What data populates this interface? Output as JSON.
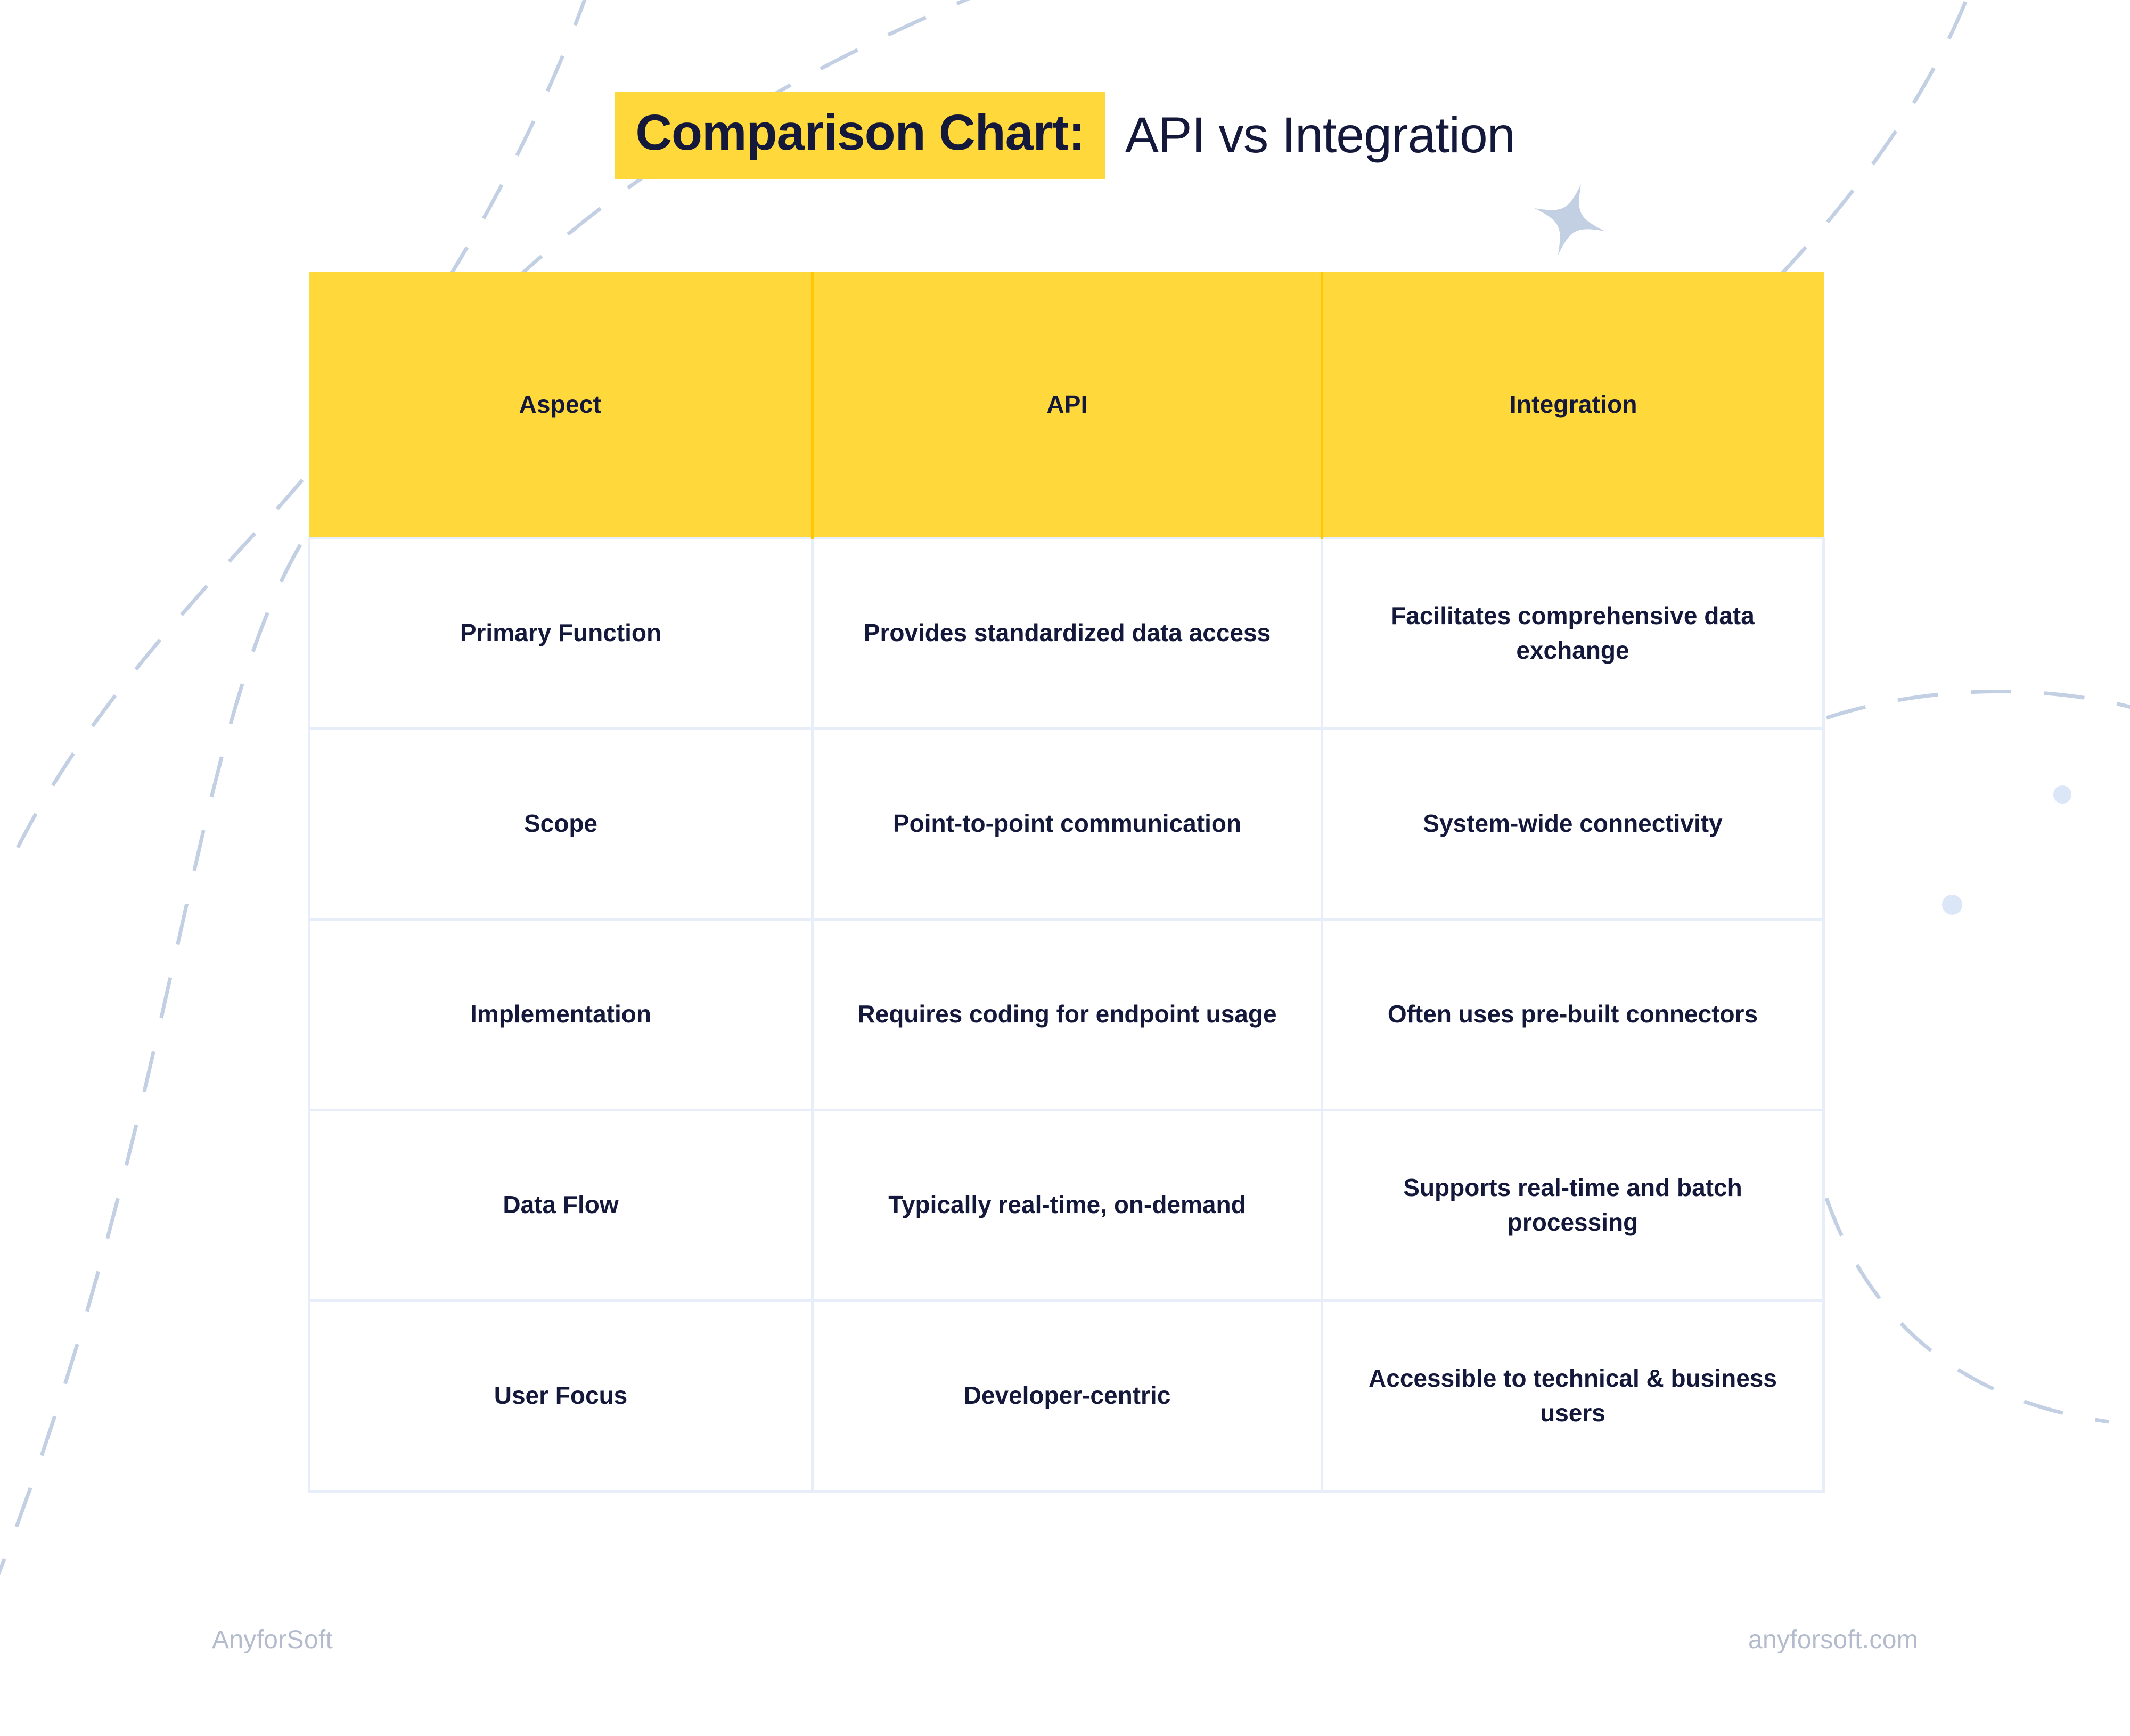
{
  "title": {
    "highlight": "Comparison Chart:",
    "rest": "API vs Integration"
  },
  "colors": {
    "accent_yellow": "#ffd93b",
    "header_divider": "#ffc700",
    "text_navy": "#14183a",
    "grid_line": "#e7eef9",
    "decor_blue": "#c3d0e4",
    "dot_blue": "#dbe6f6",
    "footer_gray": "#b3bbcd",
    "background": "#ffffff"
  },
  "chart_data": {
    "type": "table",
    "title": "Comparison Chart: API vs Integration",
    "columns": [
      "Aspect",
      "API",
      "Integration"
    ],
    "rows": [
      [
        "Primary Function",
        "Provides standardized data access",
        "Facilitates comprehensive data exchange"
      ],
      [
        "Scope",
        "Point-to-point communication",
        "System-wide connectivity"
      ],
      [
        "Implementation",
        "Requires coding for endpoint usage",
        "Often uses pre-built connectors"
      ],
      [
        "Data Flow",
        "Typically real-time, on-demand",
        "Supports real-time and batch processing"
      ],
      [
        "User Focus",
        "Developer-centric",
        "Accessible to technical & business users"
      ]
    ]
  },
  "table": {
    "headers": [
      {
        "label": "Aspect"
      },
      {
        "label": "API"
      },
      {
        "label": "Integration"
      }
    ],
    "rows": [
      {
        "aspect": "Primary Function",
        "api": "Provides standardized data access",
        "integration": "Facilitates comprehensive data exchange"
      },
      {
        "aspect": "Scope",
        "api": "Point-to-point communication",
        "integration": "System-wide connectivity"
      },
      {
        "aspect": "Implementation",
        "api": "Requires coding for endpoint usage",
        "integration": "Often uses pre-built connectors"
      },
      {
        "aspect": "Data Flow",
        "api": "Typically real-time, on-demand",
        "integration": "Supports real-time and batch processing"
      },
      {
        "aspect": "User Focus",
        "api": "Developer-centric",
        "integration": "Accessible to technical & business users"
      }
    ]
  },
  "footer": {
    "brand": "AnyforSoft",
    "site": "anyforsoft.com"
  },
  "decorations": {
    "sparkle": "four-point-star",
    "dot_count": 2,
    "dashed_curve_count": 4
  }
}
